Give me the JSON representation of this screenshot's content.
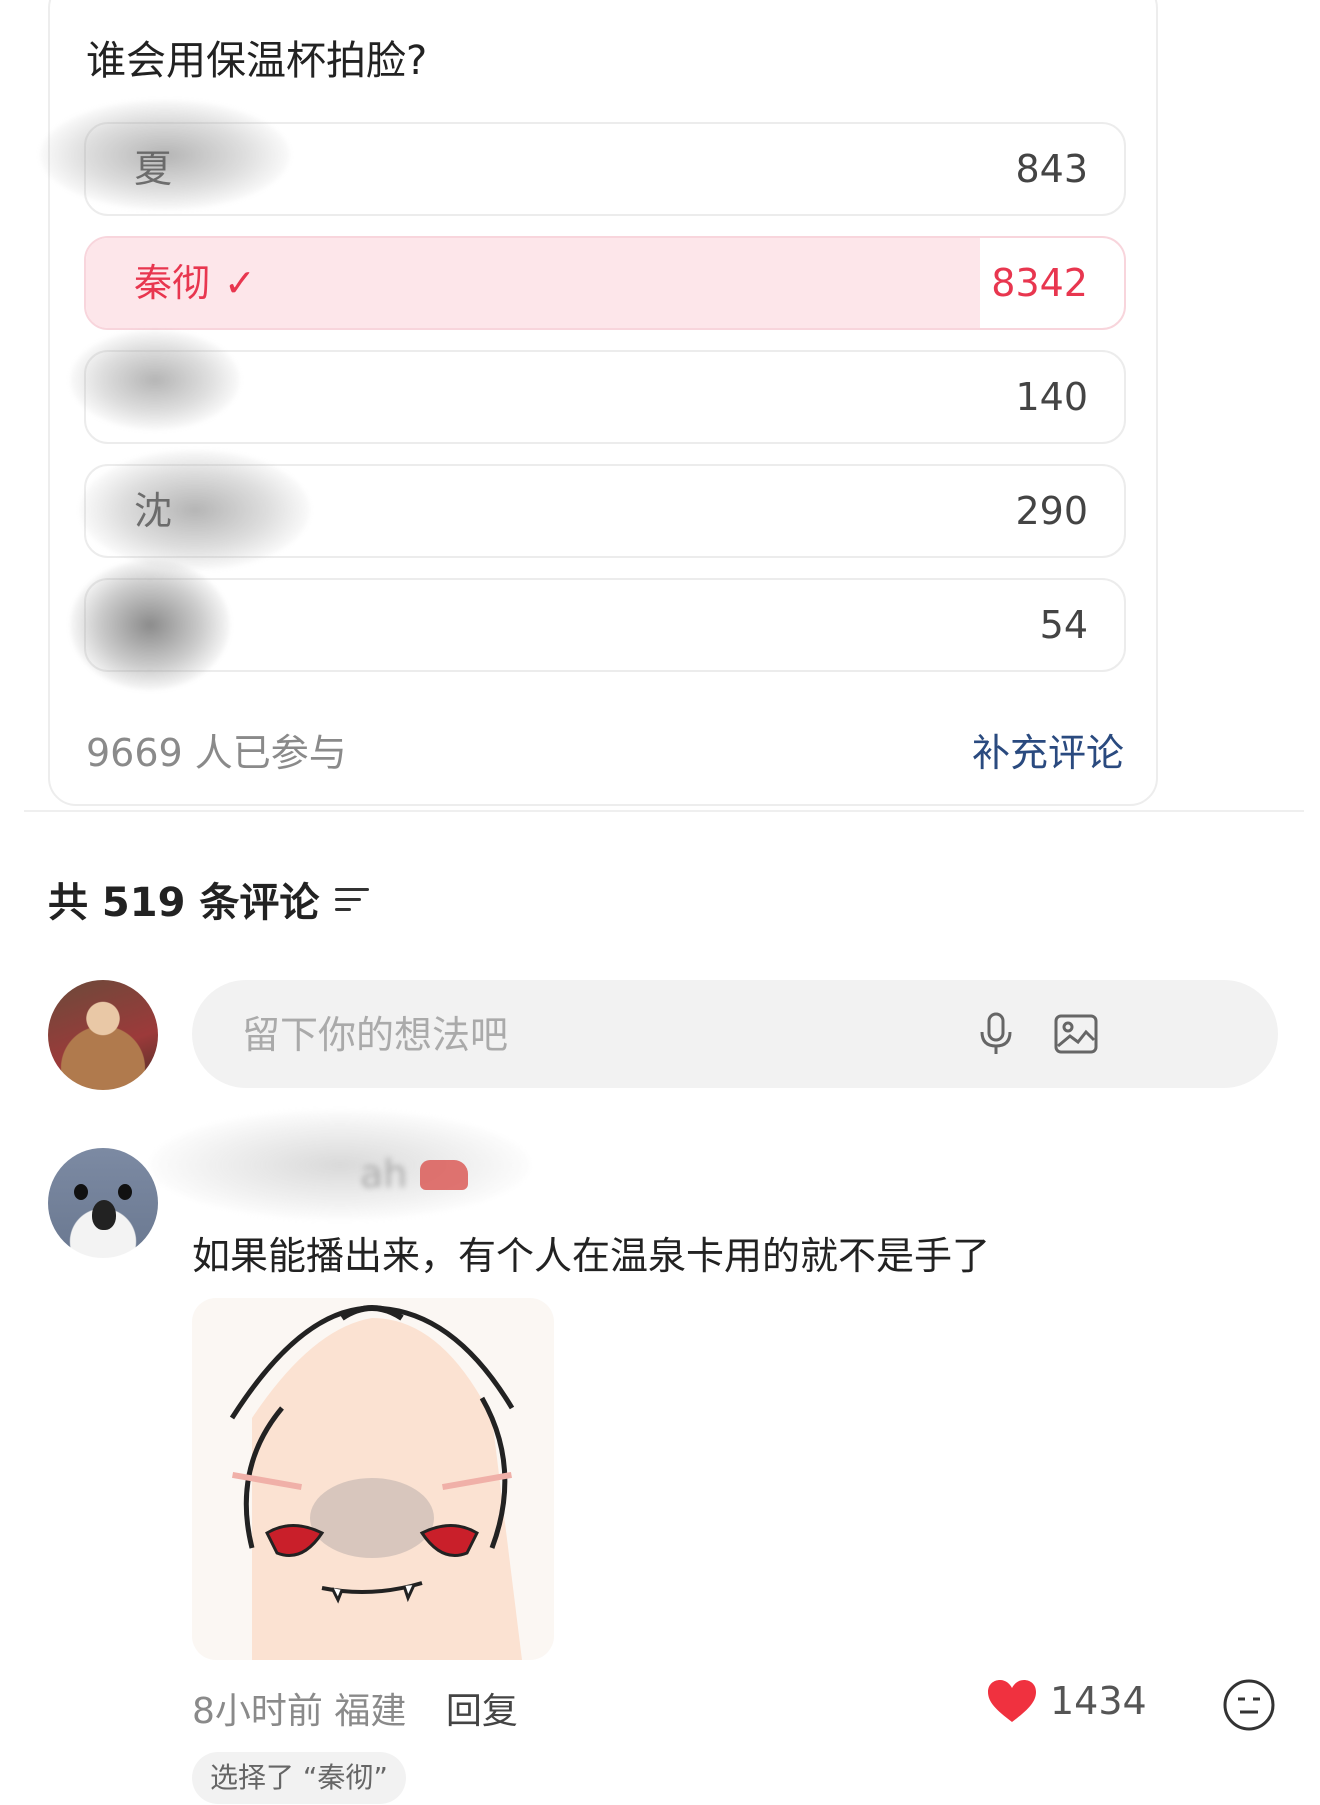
{
  "poll": {
    "question": "谁会用保温杯拍脸?",
    "options": [
      {
        "label": "夏",
        "count": "843",
        "selected": false,
        "share": 0.087
      },
      {
        "label": "秦彻",
        "count": "8342",
        "selected": true,
        "share": 0.863
      },
      {
        "label": "",
        "count": "140",
        "selected": false,
        "share": 0.014
      },
      {
        "label": "沈",
        "count": "290",
        "selected": false,
        "share": 0.03
      },
      {
        "label": "",
        "count": "54",
        "selected": false,
        "share": 0.006
      }
    ],
    "participants": "9669 人已参与",
    "add_comment": "补充评论",
    "selected_color": "#e8364f",
    "selected_fill": "#fde6ea"
  },
  "comments": {
    "header": "共 519 条评论",
    "sort_icon": "sort-filter-icon",
    "input_placeholder": "留下你的想法吧",
    "mic_icon": "microphone-icon",
    "image_icon": "image-icon"
  },
  "comment": {
    "username": "ah",
    "text": "如果能播出来，有个人在温泉卡用的就不是手了",
    "time": "8小时前",
    "location": "福建",
    "reply": "回复",
    "likes": "1434",
    "like_icon": "heart-icon",
    "emoji_icon": "emoji-face-icon",
    "choice": "选择了 “秦彻”"
  }
}
